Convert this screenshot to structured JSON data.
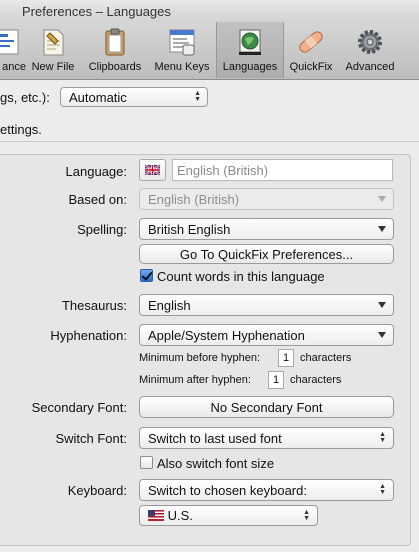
{
  "window": {
    "title": "Preferences – Languages"
  },
  "toolbar": {
    "items": [
      {
        "label": "ance",
        "icon": "appearance-icon",
        "selected": false
      },
      {
        "label": "New File",
        "icon": "new-file-icon",
        "selected": false
      },
      {
        "label": "Clipboards",
        "icon": "clipboard-icon",
        "selected": false
      },
      {
        "label": "Menu Keys",
        "icon": "menu-keys-icon",
        "selected": false
      },
      {
        "label": "Languages",
        "icon": "globe-flag-icon",
        "selected": true
      },
      {
        "label": "QuickFix",
        "icon": "bandage-icon",
        "selected": false
      },
      {
        "label": "Advanced",
        "icon": "gear-icon",
        "selected": false
      }
    ]
  },
  "top": {
    "label": "gs, etc.):",
    "popup_value": "Automatic",
    "description": "ettings."
  },
  "form": {
    "language": {
      "label": "Language:",
      "value": "English (British)"
    },
    "based_on": {
      "label": "Based on:",
      "value": "English (British)"
    },
    "spelling": {
      "label": "Spelling:",
      "value": "British English"
    },
    "quickfix_button": "Go To QuickFix Preferences...",
    "count_words": {
      "label": "Count words in this language",
      "checked": true
    },
    "thesaurus": {
      "label": "Thesaurus:",
      "value": "English"
    },
    "hyphenation": {
      "label": "Hyphenation:",
      "value": "Apple/System Hyphenation",
      "min_before_label": "Minimum before hyphen:",
      "min_before_value": "1",
      "min_after_label": "Minimum after hyphen:",
      "min_after_value": "1",
      "unit": "characters"
    },
    "secondary_font": {
      "label": "Secondary Font:",
      "button": "No Secondary Font"
    },
    "switch_font": {
      "label": "Switch Font:",
      "value": "Switch to last used font"
    },
    "also_switch_size": {
      "label": "Also switch font size",
      "checked": false
    },
    "keyboard": {
      "label": "Keyboard:",
      "value": "Switch to chosen keyboard:",
      "layout": "U.S."
    }
  }
}
